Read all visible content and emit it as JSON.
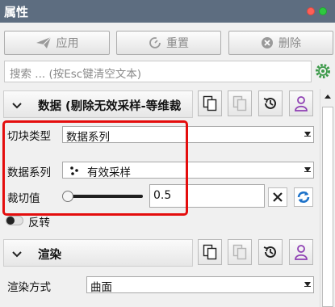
{
  "window": {
    "title": "属性"
  },
  "toolbar": {
    "apply_label": "应用",
    "reset_label": "重置",
    "delete_label": "删除"
  },
  "search": {
    "placeholder": "搜索 ... (按Esc键清空文本)"
  },
  "sections": {
    "data": {
      "title": "数据 (剔除无效采样-等维裁",
      "tile_type_label": "切块类型",
      "tile_type_value": "数据系列",
      "series_label": "数据系列",
      "series_value": "有效采样",
      "cut_label": "裁切值",
      "cut_value": "0.5",
      "invert_label": "反转"
    },
    "render": {
      "title": "渲染",
      "mode_label": "渲染方式",
      "mode_value": "曲面"
    }
  }
}
